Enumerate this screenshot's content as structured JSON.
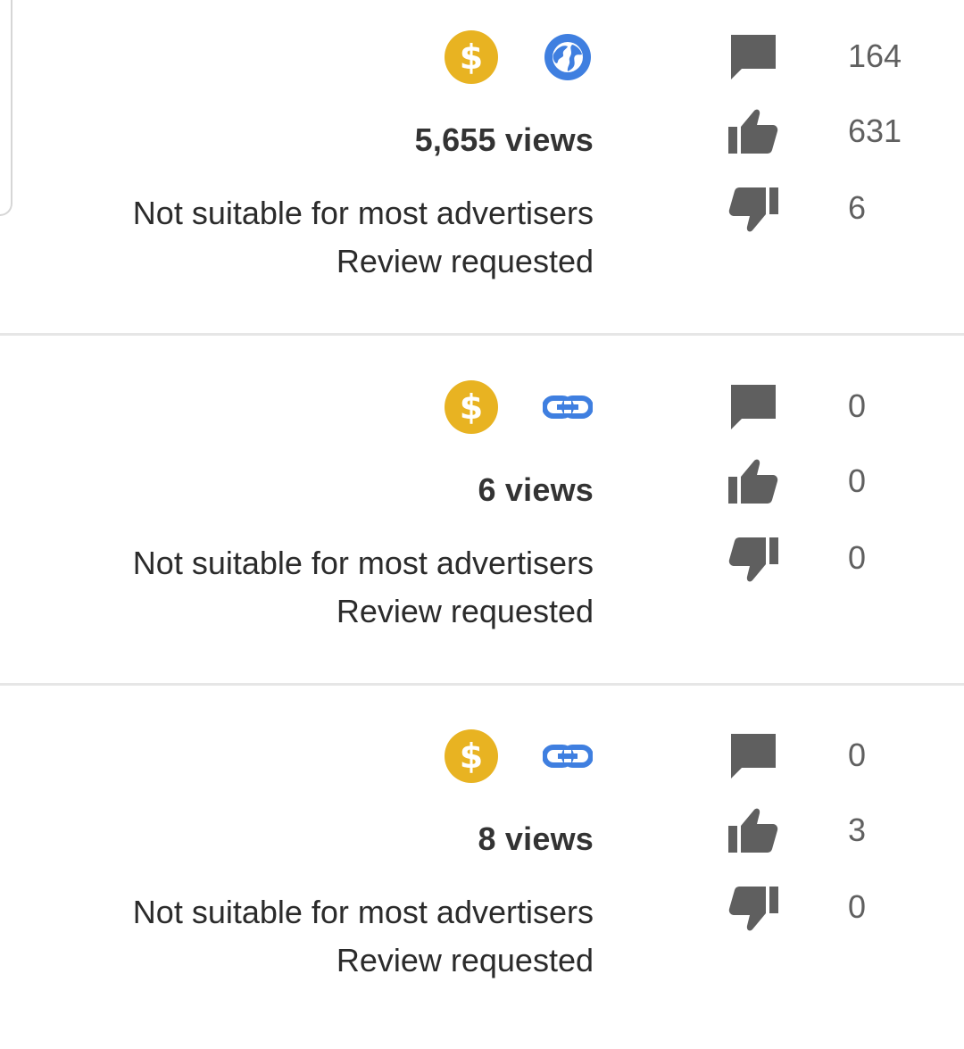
{
  "colors": {
    "monetization": "#e8b322",
    "visibility": "#3f7fe0",
    "stat_icon": "#5f5f5f",
    "stat_text": "#606060",
    "primary_text": "#2b2b2b",
    "divider": "#e6e6e6"
  },
  "videos": [
    {
      "monetization_icon": "dollar-icon",
      "monetization_symbol": "$",
      "visibility_icon": "globe-icon",
      "views": "5,655 views",
      "ad_status": "Not suitable for most advertisers",
      "review_status": "Review requested",
      "comments": "164",
      "likes": "631",
      "dislikes": "6"
    },
    {
      "monetization_icon": "dollar-icon",
      "monetization_symbol": "$",
      "visibility_icon": "link-icon",
      "views": "6 views",
      "ad_status": "Not suitable for most advertisers",
      "review_status": "Review requested",
      "comments": "0",
      "likes": "0",
      "dislikes": "0"
    },
    {
      "monetization_icon": "dollar-icon",
      "monetization_symbol": "$",
      "visibility_icon": "link-icon",
      "views": "8 views",
      "ad_status": "Not suitable for most advertisers",
      "review_status": "Review requested",
      "comments": "0",
      "likes": "3",
      "dislikes": "0"
    }
  ]
}
